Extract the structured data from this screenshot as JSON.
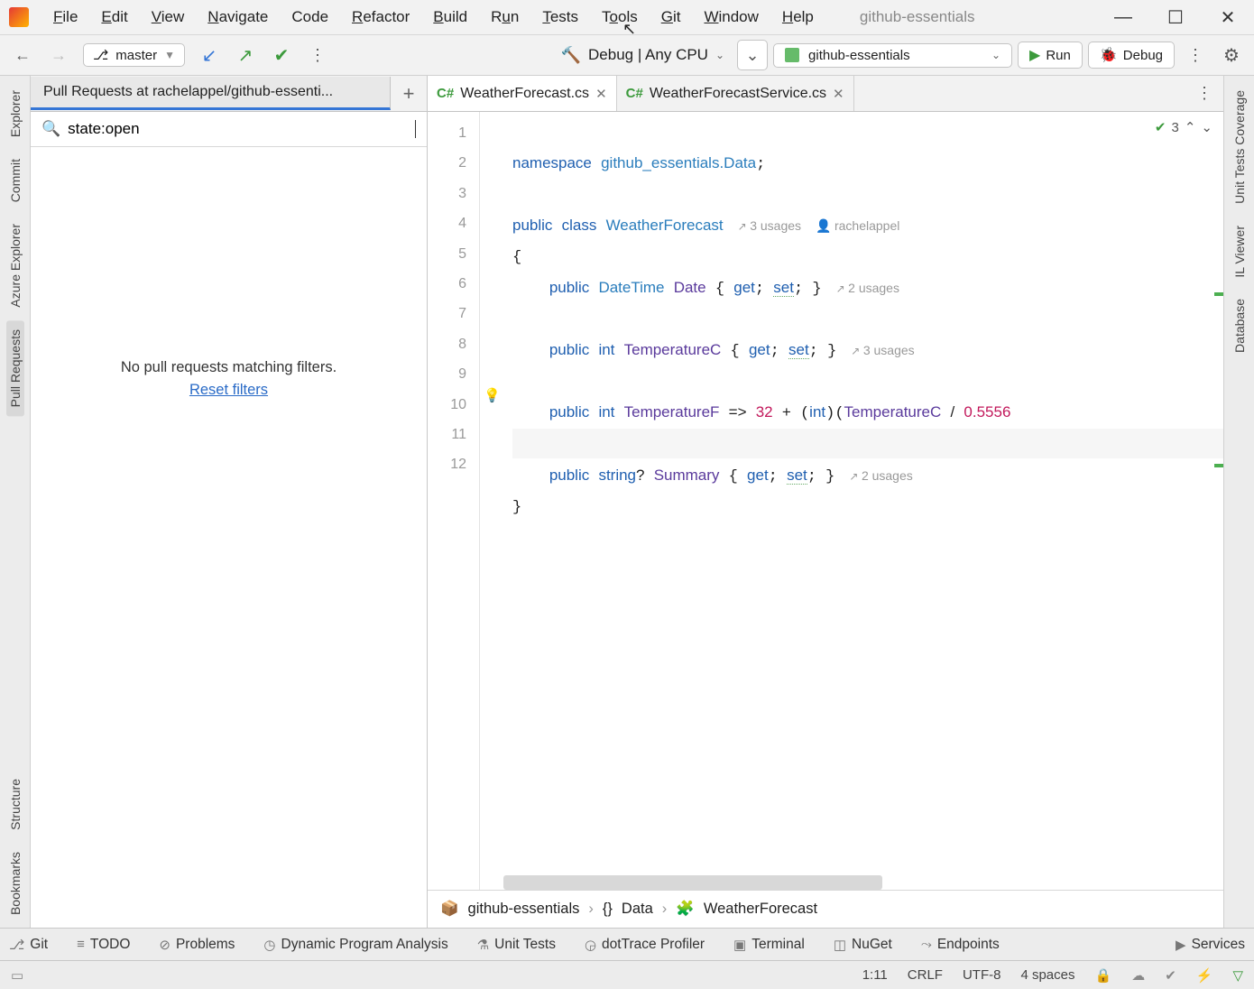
{
  "project_name": "github-essentials",
  "menu": [
    "File",
    "Edit",
    "View",
    "Navigate",
    "Code",
    "Refactor",
    "Build",
    "Run",
    "Tests",
    "Tools",
    "Git",
    "Window",
    "Help"
  ],
  "toolbar": {
    "branch": "master",
    "config": "Debug | Any CPU",
    "target": "github-essentials",
    "run": "Run",
    "debug": "Debug"
  },
  "left_strip": [
    "Explorer",
    "Commit",
    "Azure Explorer",
    "Pull Requests",
    "Structure",
    "Bookmarks"
  ],
  "right_strip": [
    "Unit Tests Coverage",
    "IL Viewer",
    "Database"
  ],
  "pull_requests": {
    "tab_title": "Pull Requests at rachelappel/github-essenti...",
    "search_value": "state:open",
    "empty_msg": "No pull requests matching filters.",
    "reset_label": "Reset filters"
  },
  "editor_tabs": [
    {
      "label": "WeatherForecast.cs",
      "active": true
    },
    {
      "label": "WeatherForecastService.cs",
      "active": false
    }
  ],
  "code_status": {
    "count": "3"
  },
  "gutter_lines": [
    "1",
    "2",
    "3",
    "4",
    "5",
    "6",
    "7",
    "8",
    "9",
    "10",
    "11",
    "12"
  ],
  "code": {
    "l1_ns": "namespace",
    "l1_name": "github_essentials.Data",
    "l3_pub": "public",
    "l3_class": "class",
    "l3_name": "WeatherForecast",
    "l3_hint_usages": "3 usages",
    "l3_hint_author": "rachelappel",
    "l5_pub": "public",
    "l5_type": "DateTime",
    "l5_prop": "Date",
    "l5_get": "get",
    "l5_set": "set",
    "l5_hint": "2 usages",
    "l7_pub": "public",
    "l7_type": "int",
    "l7_prop": "TemperatureC",
    "l7_get": "get",
    "l7_set": "set",
    "l7_hint": "3 usages",
    "l9_pub": "public",
    "l9_type": "int",
    "l9_prop": "TemperatureF",
    "l9_arrow": "=>",
    "l9_n1": "32",
    "l9_plus": "+",
    "l9_cast": "int",
    "l9_ref": "TemperatureC",
    "l9_div": "/",
    "l9_n2": "0.5556",
    "l11_pub": "public",
    "l11_type": "string",
    "l11_q": "?",
    "l11_prop": "Summary",
    "l11_get": "get",
    "l11_set": "set",
    "l11_hint": "2 usages"
  },
  "breadcrumb": {
    "proj": "github-essentials",
    "ns": "Data",
    "cls": "WeatherForecast"
  },
  "bottom_tools": [
    "Git",
    "TODO",
    "Problems",
    "Dynamic Program Analysis",
    "Unit Tests",
    "dotTrace Profiler",
    "Terminal",
    "NuGet",
    "Endpoints",
    "Services"
  ],
  "status": {
    "pos": "1:11",
    "eol": "CRLF",
    "enc": "UTF-8",
    "indent": "4 spaces"
  }
}
